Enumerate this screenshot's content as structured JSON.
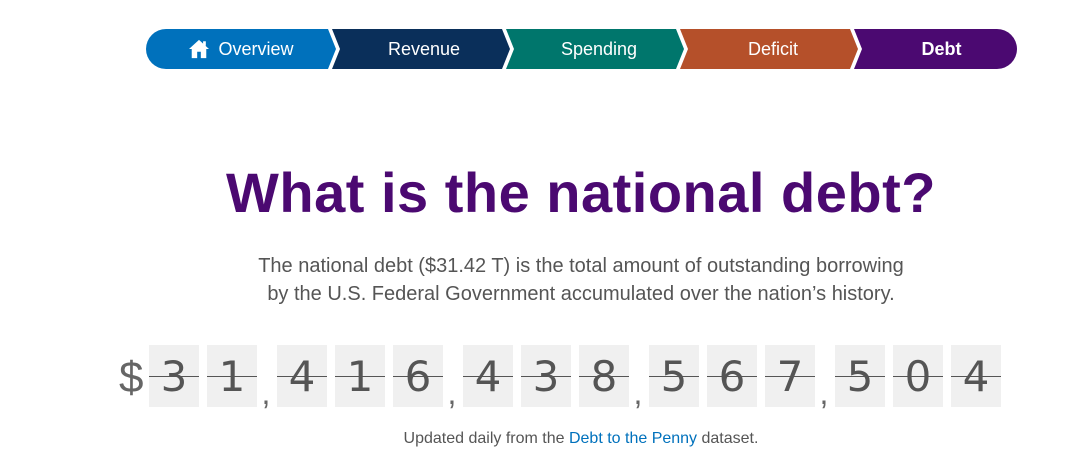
{
  "nav": {
    "items": [
      {
        "label": "Overview",
        "icon": "home-icon",
        "color": "#0071bc"
      },
      {
        "label": "Revenue",
        "color": "#0a2f5a"
      },
      {
        "label": "Spending",
        "color": "#00766c"
      },
      {
        "label": "Deficit",
        "color": "#b5502a"
      },
      {
        "label": "Debt",
        "color": "#4b0971",
        "active": true
      }
    ]
  },
  "main": {
    "title": "What is the national debt?",
    "description_line1": "The national debt ($31.42 T) is the total amount of outstanding borrowing",
    "description_line2": "by the U.S. Federal Government accumulated over the nation’s history.",
    "counter": {
      "currency": "$",
      "digits": [
        "3",
        "1",
        "4",
        "1",
        "6",
        "4",
        "3",
        "8",
        "5",
        "6",
        "7",
        "5",
        "0",
        "4"
      ],
      "separator": ",",
      "value": "$31,416,438,567,504"
    },
    "note_prefix": "Updated daily from the ",
    "note_link": "Debt to the Penny",
    "note_suffix": " dataset."
  },
  "colors": {
    "title": "#4b0971",
    "link": "#0071bc",
    "digit_bg": "#f0f0f0"
  }
}
